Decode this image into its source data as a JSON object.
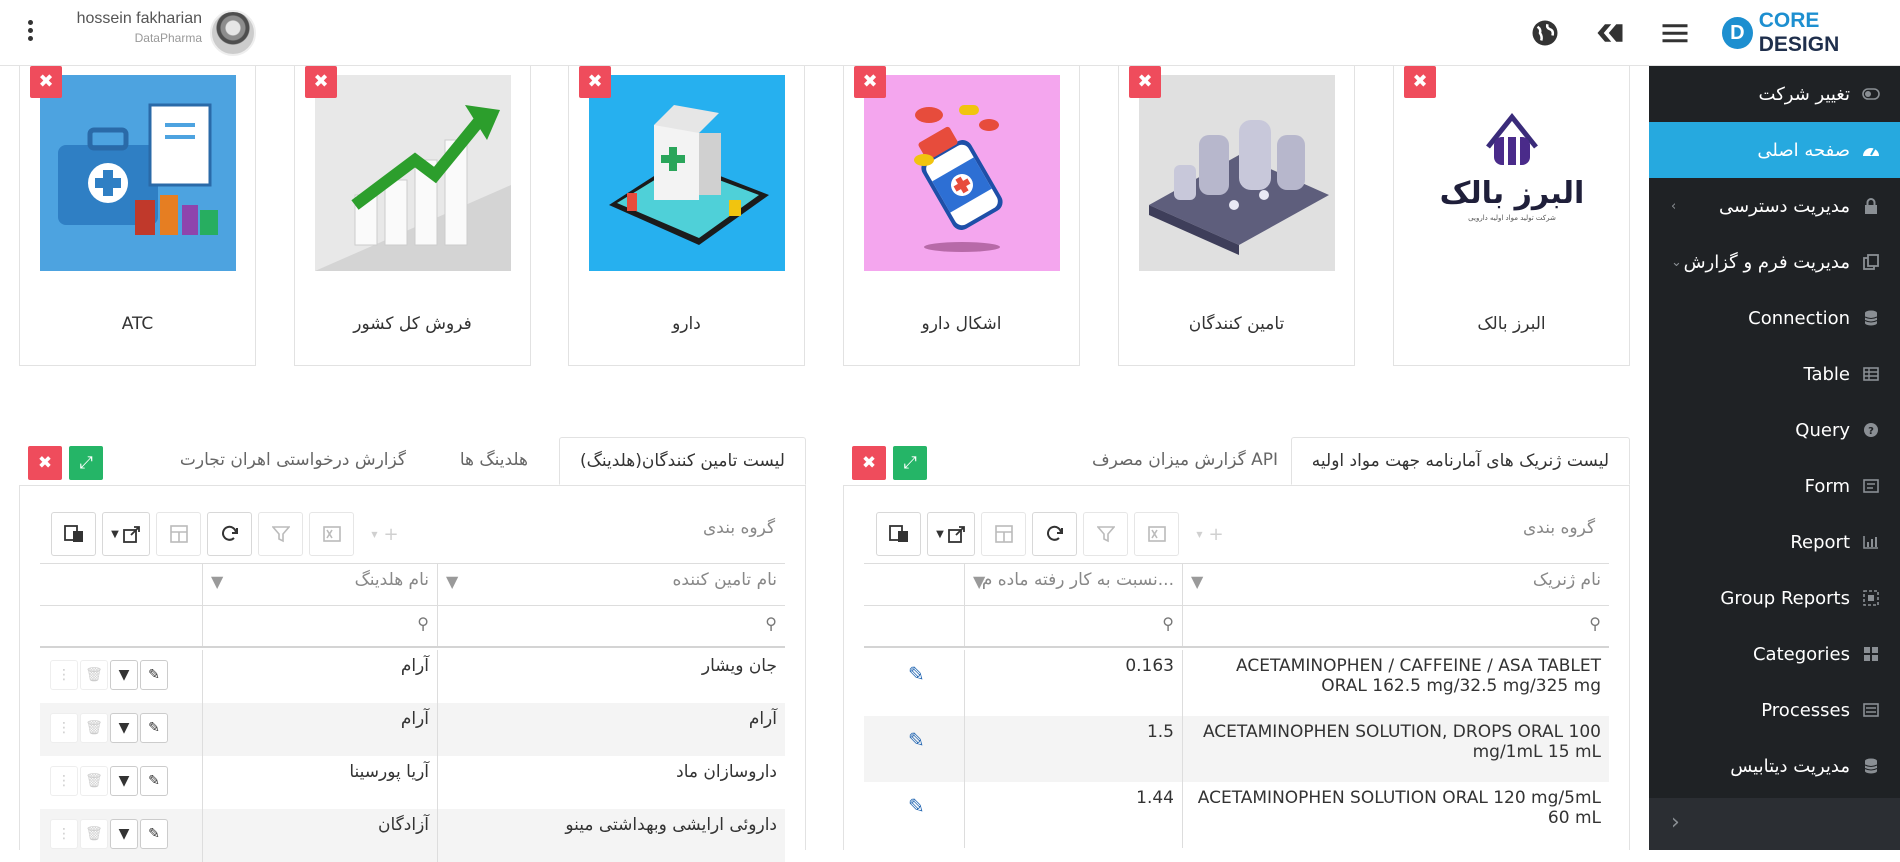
{
  "header": {
    "user_name": "hossein fakharian",
    "user_company": "DataPharma",
    "logo_letter": "D",
    "logo_text_a": "CORE",
    "logo_text_b": "DESIGN"
  },
  "sidebar": {
    "items": [
      {
        "label": "تغییر شرکت",
        "icon": "toggle-icon"
      },
      {
        "label": "صفحه اصلی",
        "icon": "dashboard-icon"
      },
      {
        "label": "مدیریت دسترسی",
        "icon": "lock-icon"
      },
      {
        "label": "مدیریت فرم و گزارش",
        "icon": "copy-icon"
      },
      {
        "label": "Connection",
        "icon": "database-icon"
      },
      {
        "label": "Table",
        "icon": "table-icon"
      },
      {
        "label": "Query",
        "icon": "question-icon"
      },
      {
        "label": "Form",
        "icon": "form-icon"
      },
      {
        "label": "Report",
        "icon": "bar-chart-icon"
      },
      {
        "label": "Group Reports",
        "icon": "group-reports-icon"
      },
      {
        "label": "Categories",
        "icon": "grid-icon"
      },
      {
        "label": "Processes",
        "icon": "processes-icon"
      },
      {
        "label": "مدیریت دیتابیس",
        "icon": "database-icon"
      }
    ]
  },
  "cards": [
    {
      "caption": "ATC",
      "color": "#4da3e0"
    },
    {
      "caption": "فروش کل کشور",
      "color": "#e8e8e8"
    },
    {
      "caption": "دارو",
      "color": "#26b0ef"
    },
    {
      "caption": "اشکال دارو",
      "color": "#f4a6ee"
    },
    {
      "caption": "تامین کنندگان",
      "color": "#e0e0e0"
    },
    {
      "caption": "البرز بالک",
      "color": "#ffffff",
      "logo_text": "البرز بالک",
      "logo_sub": "شرکت تولید مواد اولیه دارویی"
    }
  ],
  "delete_glyph": "✖",
  "left_panel": {
    "tabs": [
      "لیست تامین کنندگان(هلدینگ)",
      "هلدینگ ها",
      "گزارش درخواستی اهران تجارت"
    ],
    "group_by_label": "گروه بندی",
    "columns": [
      "نام تامین کننده",
      "نام هلدینگ"
    ],
    "rows": [
      [
        "جان ویشار",
        "آرام"
      ],
      [
        "آرام",
        "آرام"
      ],
      [
        "داروسازان ماد",
        "آریا پورسینا"
      ],
      [
        "داروئی ارایشی وبهداشتی مینو",
        "آزادگان"
      ]
    ]
  },
  "right_panel": {
    "tabs": [
      "لیست ژنریک های آمارنامه جهت مواد اولیه",
      "گزارش میزان مصرف API"
    ],
    "group_by_label": "گروه بندی",
    "columns": [
      "نام ژنریک",
      "نسبت به کار رفته ماده م..."
    ],
    "rows": [
      [
        "ACETAMINOPHEN / CAFFEINE / ASA TABLET ORAL 162.5 mg/32.5 mg/325 mg",
        "0.163"
      ],
      [
        "ACETAMINOPHEN SOLUTION, DROPS ORAL 100 mg/1mL 15 mL",
        "1.5"
      ],
      [
        "ACETAMINOPHEN SOLUTION ORAL 120 mg/5mL 60 mL",
        "1.44"
      ]
    ]
  }
}
